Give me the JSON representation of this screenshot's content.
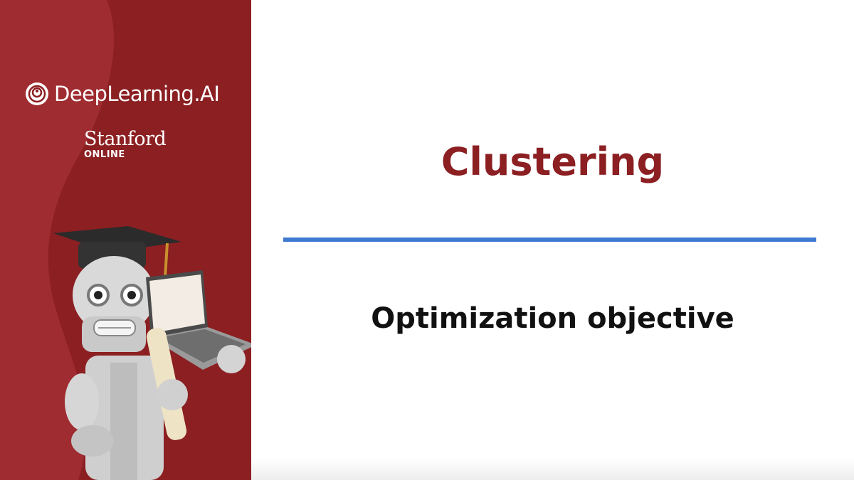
{
  "brand": {
    "deeplearning_label": "DeepLearning.AI",
    "stanford_label": "Stanford",
    "stanford_sub": "ONLINE",
    "sidebar_color": "#8b1f22"
  },
  "slide": {
    "title": "Clustering",
    "subtitle": "Optimization objective",
    "title_color": "#8b1f22",
    "divider_color": "#3f7ad2"
  },
  "icons": {
    "logo": "deeplearning-spiral-logo",
    "mascot": "graduate-robot-with-laptop"
  }
}
